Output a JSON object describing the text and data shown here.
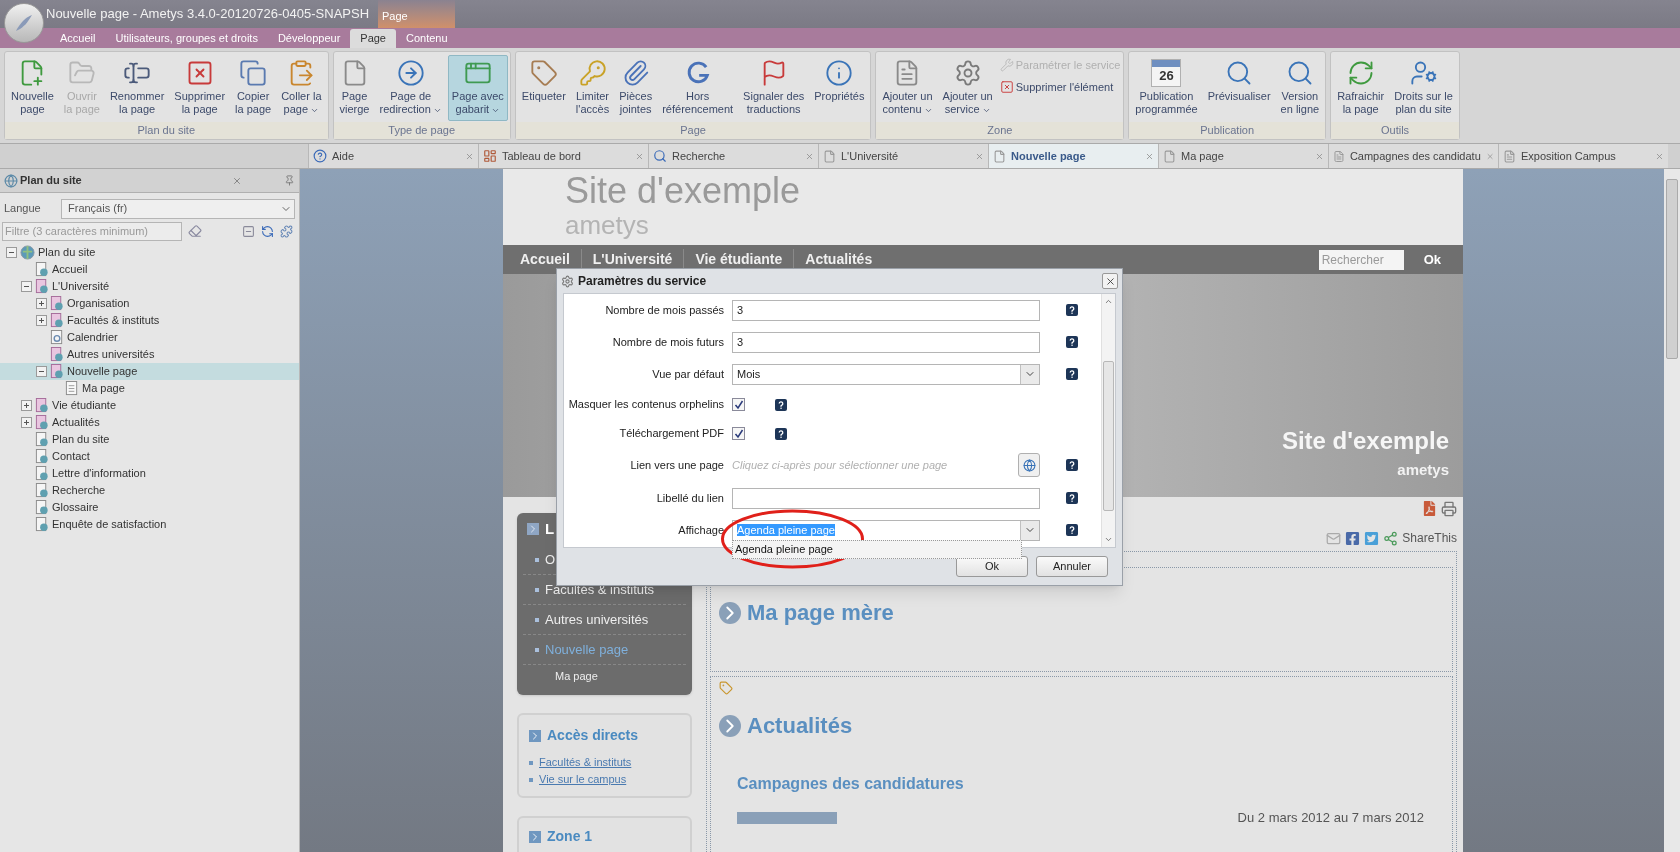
{
  "window": {
    "title": "Nouvelle page - Ametys 3.4.0-20120726-0405-SNAPSH",
    "context_label": "Page"
  },
  "ribbon_tabs": [
    {
      "label": "Accueil",
      "selected": false
    },
    {
      "label": "Utilisateurs, groupes et droits",
      "selected": false
    },
    {
      "label": "Développeur",
      "selected": false
    },
    {
      "label": "Page",
      "selected": true
    },
    {
      "label": "Contenu",
      "selected": false
    }
  ],
  "ribbon_groups": [
    {
      "label": "Plan du site",
      "buttons": [
        {
          "kind": "large",
          "label": "Nouvelle\npage",
          "disabled": false,
          "menu": false,
          "pressed": false
        },
        {
          "kind": "large",
          "label": "Ouvrir\nla page",
          "disabled": true,
          "menu": false,
          "pressed": false
        },
        {
          "kind": "large",
          "label": "Renommer\nla page",
          "disabled": false,
          "menu": false,
          "pressed": false
        },
        {
          "kind": "large",
          "label": "Supprimer\nla page",
          "disabled": false,
          "menu": false,
          "pressed": false
        },
        {
          "kind": "large",
          "label": "Copier\nla page",
          "disabled": false,
          "menu": false,
          "pressed": false
        },
        {
          "kind": "large",
          "label": "Coller la\npage",
          "disabled": false,
          "menu": true,
          "pressed": false
        }
      ]
    },
    {
      "label": "Type de page",
      "buttons": [
        {
          "kind": "large",
          "label": "Page\nvierge",
          "disabled": false,
          "menu": false,
          "pressed": false
        },
        {
          "kind": "large",
          "label": "Page de\nredirection",
          "disabled": false,
          "menu": true,
          "pressed": false
        },
        {
          "kind": "large",
          "label": "Page avec\ngabarit",
          "disabled": false,
          "menu": true,
          "pressed": true
        }
      ]
    },
    {
      "label": "Page",
      "buttons": [
        {
          "kind": "large",
          "label": "Etiqueter",
          "disabled": false,
          "menu": false,
          "pressed": false
        },
        {
          "kind": "large",
          "label": "Limiter\nl'accès",
          "disabled": false,
          "menu": false,
          "pressed": false
        },
        {
          "kind": "large",
          "label": "Pièces\njointes",
          "disabled": false,
          "menu": false,
          "pressed": false
        },
        {
          "kind": "large",
          "label": "Hors\nréférencement",
          "disabled": false,
          "menu": false,
          "pressed": false
        },
        {
          "kind": "large",
          "label": "Signaler des\ntraductions",
          "disabled": false,
          "menu": false,
          "pressed": false
        },
        {
          "kind": "large",
          "label": "Propriétés",
          "disabled": false,
          "menu": false,
          "pressed": false
        }
      ]
    },
    {
      "label": "Zone",
      "buttons": [
        {
          "kind": "large",
          "label": "Ajouter un\ncontenu",
          "disabled": false,
          "menu": true,
          "pressed": false
        },
        {
          "kind": "large",
          "label": "Ajouter un\nservice",
          "disabled": false,
          "menu": true,
          "pressed": false
        },
        {
          "kind": "small",
          "label": "Paramétrer le service",
          "disabled": true,
          "menu": false,
          "pressed": false
        },
        {
          "kind": "small",
          "label": "Supprimer l'élément",
          "disabled": false,
          "menu": false,
          "pressed": false
        }
      ]
    },
    {
      "label": "Publication",
      "buttons": [
        {
          "kind": "large",
          "label": "Publication\nprogrammée",
          "icon_text": "26",
          "disabled": false,
          "menu": false,
          "pressed": false
        },
        {
          "kind": "large",
          "label": "Prévisualiser",
          "disabled": false,
          "menu": false,
          "pressed": false
        },
        {
          "kind": "large",
          "label": "Version\nen ligne",
          "disabled": false,
          "menu": false,
          "pressed": false
        }
      ]
    },
    {
      "label": "Outils",
      "buttons": [
        {
          "kind": "large",
          "label": "Rafraichir\nla page",
          "disabled": false,
          "menu": false,
          "pressed": false
        },
        {
          "kind": "large",
          "label": "Droits sur le\nplan du site",
          "disabled": false,
          "menu": false,
          "pressed": false
        }
      ]
    }
  ],
  "sidebar": {
    "title": "Plan du site",
    "language_label": "Langue",
    "language_value": "Français (fr)",
    "filter_placeholder": "Filtre (3 caractères minimum)",
    "tree": {
      "label": "Plan du site",
      "kind": "root",
      "expandable": true,
      "expanded": true,
      "selected": false,
      "children": [
        {
          "label": "Accueil",
          "kind": "page",
          "expandable": false,
          "selected": false
        },
        {
          "label": "L'Université",
          "kind": "section",
          "expandable": true,
          "expanded": true,
          "selected": false,
          "children": [
            {
              "label": "Organisation",
              "kind": "section",
              "expandable": true,
              "expanded": false,
              "selected": false
            },
            {
              "label": "Facultés & instituts",
              "kind": "section",
              "expandable": true,
              "expanded": false,
              "selected": false
            },
            {
              "label": "Calendrier",
              "kind": "calendar",
              "expandable": false,
              "selected": false
            },
            {
              "label": "Autres universités",
              "kind": "section",
              "expandable": false,
              "selected": false
            },
            {
              "label": "Nouvelle page",
              "kind": "section",
              "expandable": true,
              "expanded": true,
              "selected": true,
              "children": [
                {
                  "label": "Ma page",
                  "kind": "blank",
                  "expandable": false,
                  "selected": false
                }
              ]
            }
          ]
        },
        {
          "label": "Vie étudiante",
          "kind": "section",
          "expandable": true,
          "expanded": false,
          "selected": false
        },
        {
          "label": "Actualités",
          "kind": "section",
          "expandable": true,
          "expanded": false,
          "selected": false
        },
        {
          "label": "Plan du site",
          "kind": "page",
          "expandable": false,
          "selected": false
        },
        {
          "label": "Contact",
          "kind": "page",
          "expandable": false,
          "selected": false
        },
        {
          "label": "Lettre d'information",
          "kind": "page",
          "expandable": false,
          "selected": false
        },
        {
          "label": "Recherche",
          "kind": "page",
          "expandable": false,
          "selected": false
        },
        {
          "label": "Glossaire",
          "kind": "page",
          "expandable": false,
          "selected": false
        },
        {
          "label": "Enquête de satisfaction",
          "kind": "page",
          "expandable": false,
          "selected": false
        }
      ]
    }
  },
  "doc_tabs": [
    {
      "label": "Aide",
      "kind": "help",
      "selected": false
    },
    {
      "label": "Tableau de bord",
      "kind": "dashboard",
      "selected": false
    },
    {
      "label": "Recherche",
      "kind": "search",
      "selected": false
    },
    {
      "label": "L'Université",
      "kind": "page",
      "selected": false
    },
    {
      "label": "Nouvelle page",
      "kind": "page",
      "selected": true
    },
    {
      "label": "Ma page",
      "kind": "page",
      "selected": false
    },
    {
      "label": "Campagnes des candidatu",
      "kind": "content",
      "selected": false
    },
    {
      "label": "Exposition Campus",
      "kind": "content",
      "selected": false
    }
  ],
  "preview": {
    "site_title": "Site d'exemple",
    "site_logo": "ametys",
    "nav": [
      "Accueil",
      "L'Université",
      "Vie étudiante",
      "Actualités"
    ],
    "search_placeholder": "Rechercher",
    "search_button": "Ok",
    "banner_title": "Site d'exemple",
    "banner_subtitle": "ametys",
    "side_nav": {
      "title": "L",
      "items": [
        {
          "label": "O",
          "current": false,
          "sub": false
        },
        {
          "label": "Facultés & instituts",
          "current": false,
          "sub": false
        },
        {
          "label": "Autres universités",
          "current": false,
          "sub": false
        },
        {
          "label": "Nouvelle page",
          "current": true,
          "sub": false
        },
        {
          "label": "Ma page",
          "current": false,
          "sub": true
        }
      ]
    },
    "quick_links": {
      "title": "Accès directs",
      "links": [
        "Facultés & instituts",
        "Vie sur le campus"
      ]
    },
    "zone_title": "Zone 1",
    "share_label": "ShareThis",
    "parent_title": "Ma page mère",
    "news_title": "Actualités",
    "news_item_title": "Campagnes des candidatures",
    "news_item_date": "Du 2 mars 2012 au 7 mars 2012"
  },
  "dialog": {
    "title": "Paramètres du service",
    "fields": [
      {
        "kind": "text",
        "label": "Nombre de mois passés",
        "value": "3"
      },
      {
        "kind": "text",
        "label": "Nombre de mois futurs",
        "value": "3"
      },
      {
        "kind": "select",
        "label": "Vue par défaut",
        "value": "Mois",
        "text_selected": false,
        "open": false
      },
      {
        "kind": "checkbox",
        "label": "Masquer les contenus orphelins",
        "checked": true
      },
      {
        "kind": "checkbox",
        "label": "Téléchargement PDF",
        "checked": true
      },
      {
        "kind": "link",
        "label": "Lien vers une page",
        "placeholder": "Cliquez ci-après pour sélectionner une page"
      },
      {
        "kind": "text",
        "label": "Libellé du lien"
      },
      {
        "kind": "select",
        "label": "Affichage",
        "value": "Agenda pleine page",
        "text_selected": true,
        "open": true,
        "options": [
          "Agenda pleine page"
        ]
      }
    ],
    "buttons": [
      "Ok",
      "Annuler"
    ]
  }
}
